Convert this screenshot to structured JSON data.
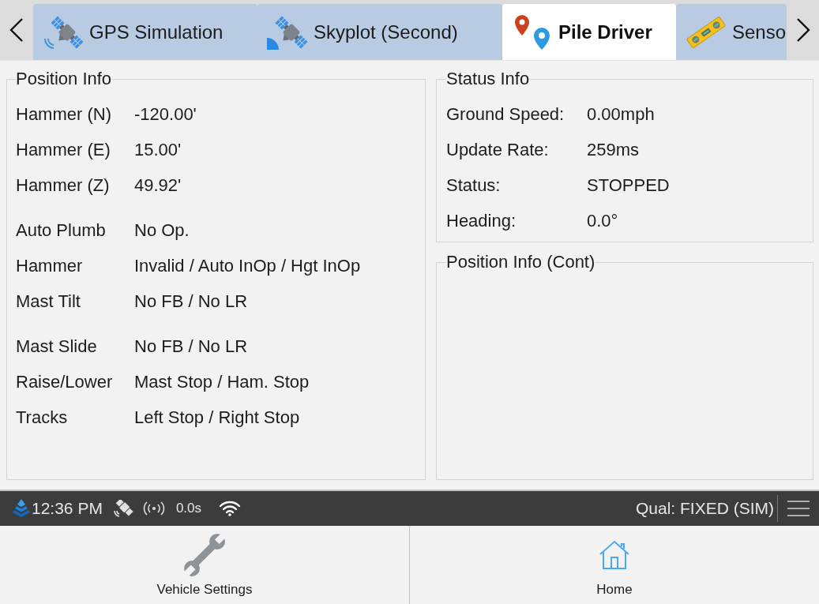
{
  "tab_bar": {
    "tabs": [
      {
        "kind": "satellite",
        "label": "GPS Simulation",
        "selected": false
      },
      {
        "kind": "skyplot",
        "label": "Skyplot (Second)",
        "selected": false
      },
      {
        "kind": "pins",
        "label": "Pile Driver",
        "selected": true
      },
      {
        "kind": "level",
        "label": "Senso",
        "selected": false
      }
    ]
  },
  "position_info": {
    "title": "Position Info",
    "groups": [
      [
        {
          "label": "Hammer (N)",
          "value": "-120.00'"
        },
        {
          "label": "Hammer (E)",
          "value": "15.00'"
        },
        {
          "label": "Hammer (Z)",
          "value": "49.92'"
        }
      ],
      [
        {
          "label": "Auto Plumb",
          "value": "No Op."
        },
        {
          "label": "Hammer",
          "value": "Invalid / Auto InOp / Hgt InOp"
        },
        {
          "label": "Mast Tilt",
          "value": "No FB / No LR"
        }
      ],
      [
        {
          "label": "Mast Slide",
          "value": "No FB / No LR"
        },
        {
          "label": "Raise/Lower",
          "value": "Mast Stop / Ham. Stop"
        },
        {
          "label": "Tracks",
          "value": "Left Stop / Right Stop"
        }
      ]
    ]
  },
  "status_info": {
    "title": "Status Info",
    "rows": [
      {
        "label": "Ground Speed:",
        "value": "0.00mph"
      },
      {
        "label": "Update Rate:",
        "value": "259ms"
      },
      {
        "label": "Status:",
        "value": "STOPPED"
      },
      {
        "label": "Heading:",
        "value": "0.0°"
      }
    ]
  },
  "position_info_cont": {
    "title": "Position Info (Cont)"
  },
  "status_bar": {
    "time": "12:36 PM",
    "correction_age": "0.0s",
    "quality": "Qual: FIXED (SIM)"
  },
  "bottom_bar": {
    "buttons": [
      {
        "kind": "settings",
        "label": "Vehicle Settings"
      },
      {
        "kind": "home",
        "label": "Home"
      }
    ]
  }
}
